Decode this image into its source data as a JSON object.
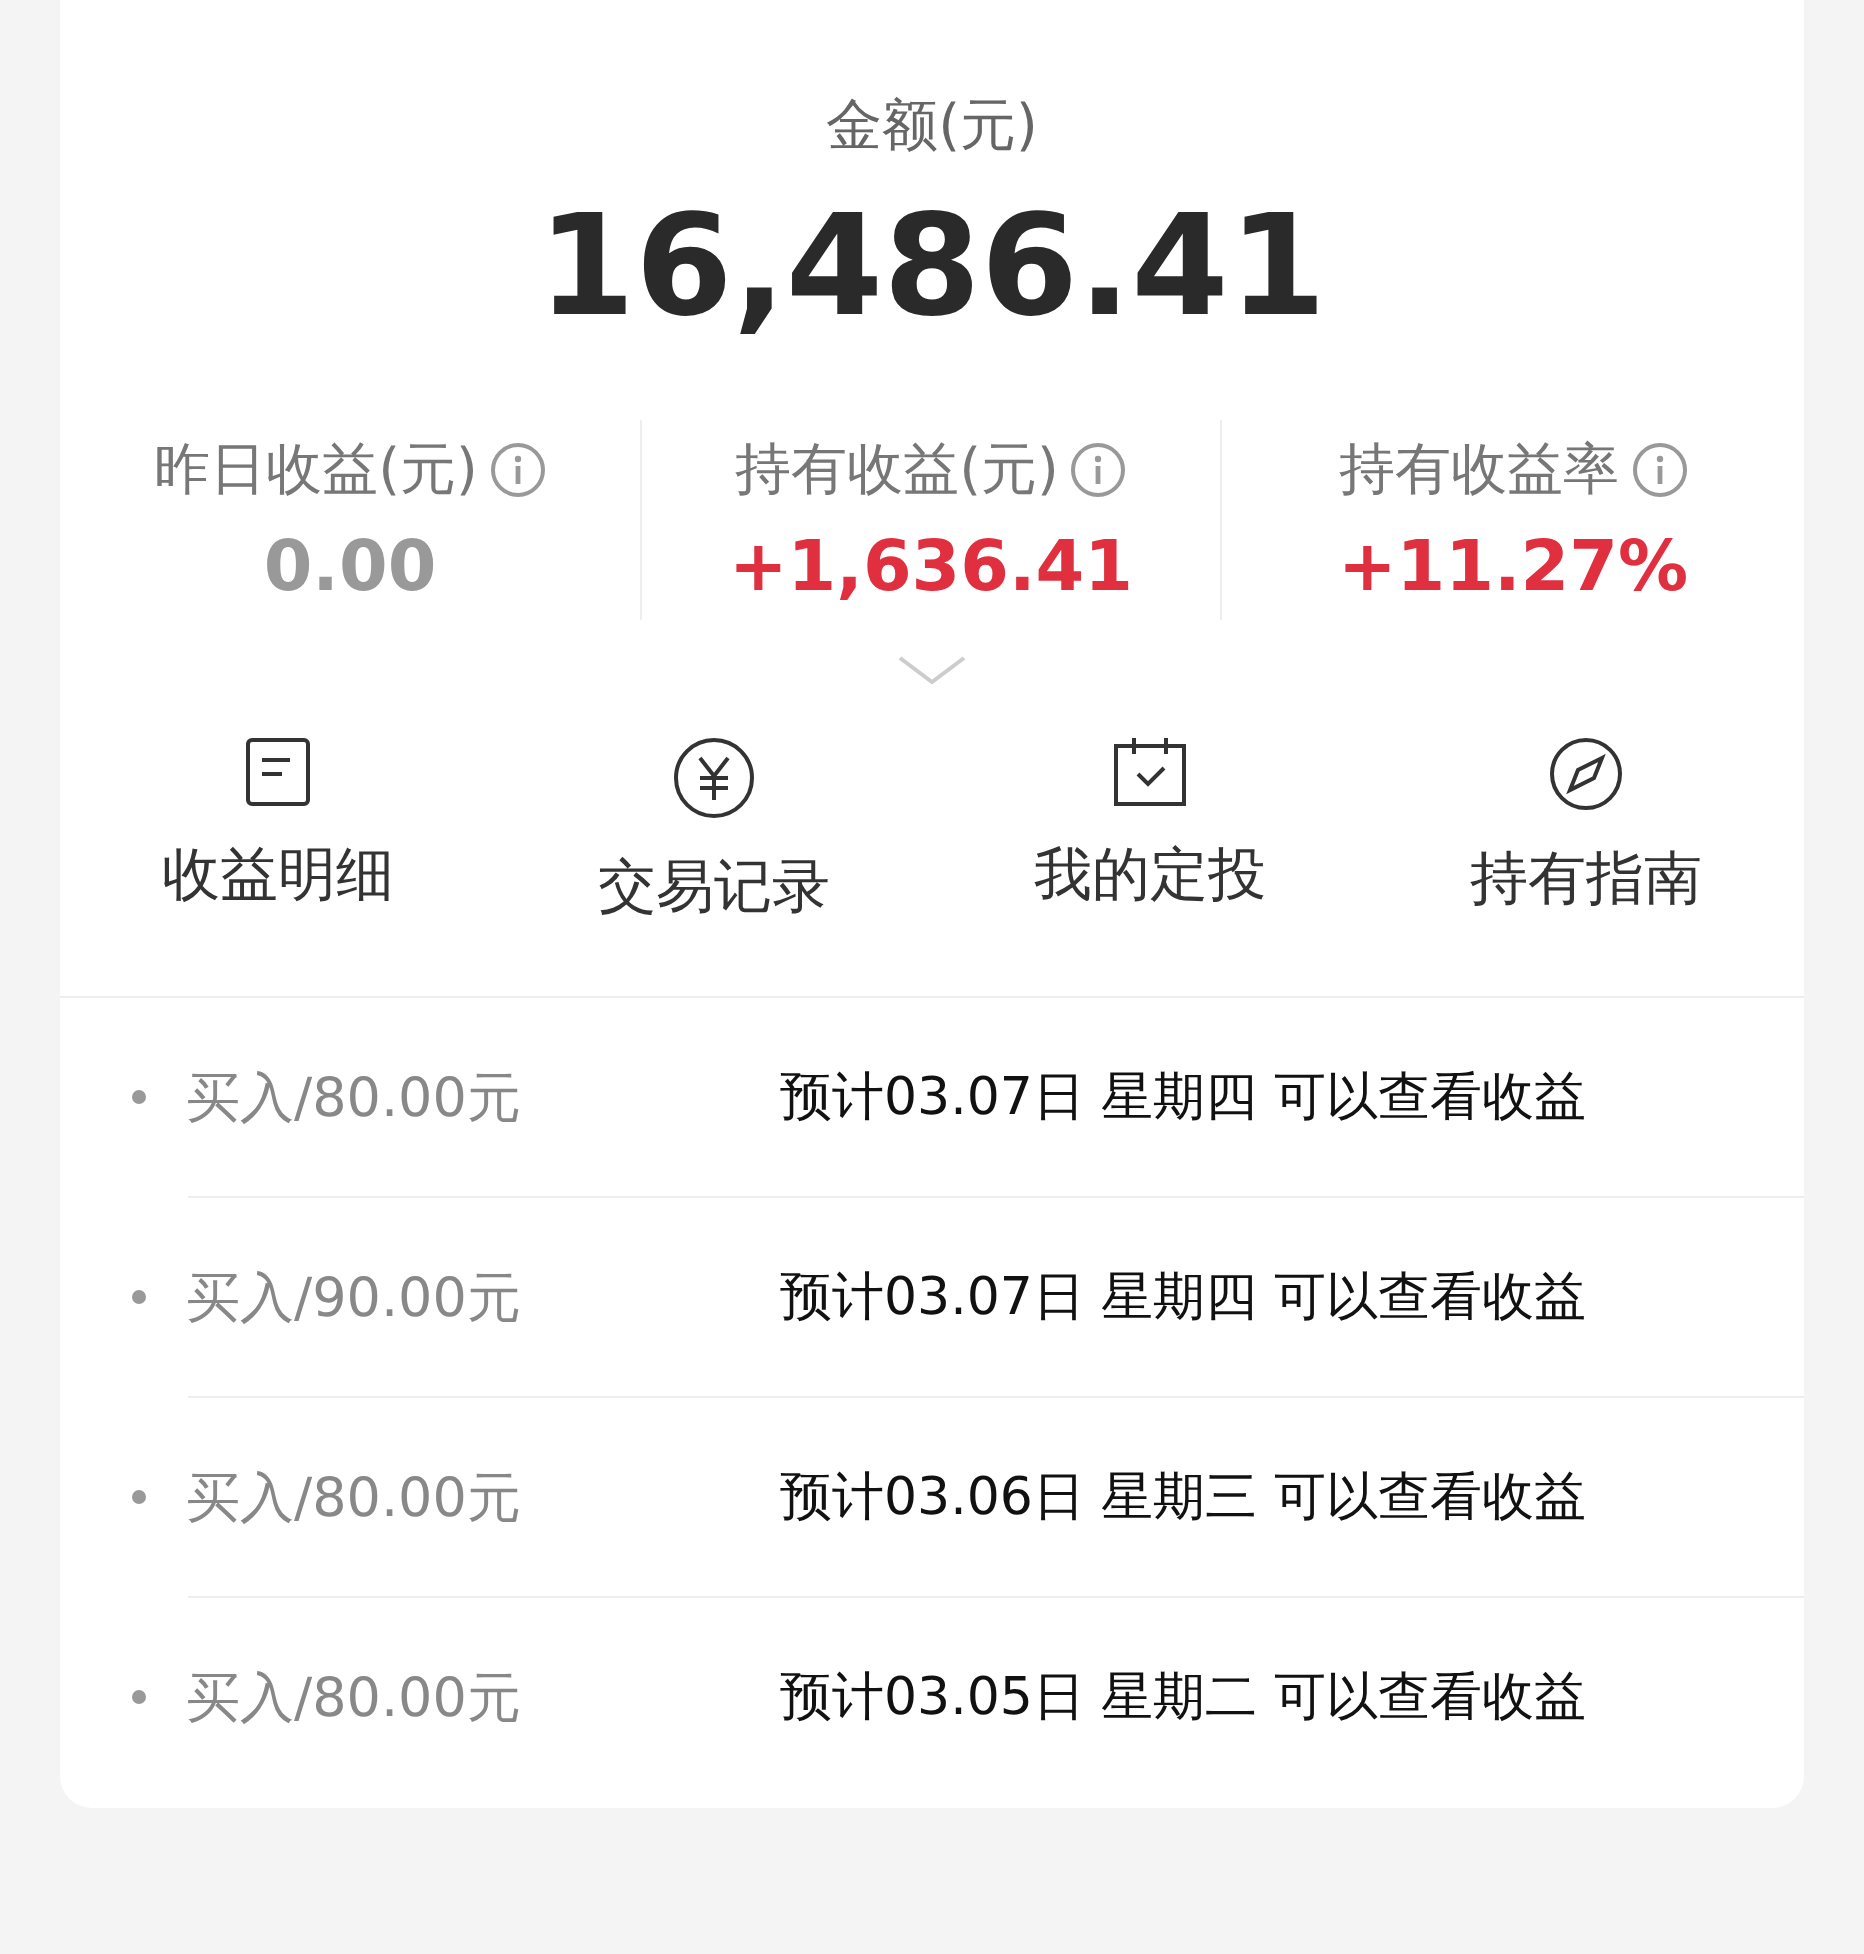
{
  "balance": {
    "label": "金额(元)",
    "amount": "16,486.41"
  },
  "stats": [
    {
      "label": "昨日收益(元)",
      "value": "0.00",
      "kind": "neutral"
    },
    {
      "label": "持有收益(元)",
      "value": "+1,636.41",
      "kind": "gain"
    },
    {
      "label": "持有收益率",
      "value": "+11.27%",
      "kind": "gain"
    }
  ],
  "actions": [
    {
      "label": "收益明细",
      "kind": "document"
    },
    {
      "label": "交易记录",
      "kind": "yen"
    },
    {
      "label": "我的定投",
      "kind": "calendar"
    },
    {
      "label": "持有指南",
      "kind": "compass"
    }
  ],
  "records": [
    {
      "title": "买入/80.00元",
      "note": "预计03.07日 星期四 可以查看收益"
    },
    {
      "title": "买入/90.00元",
      "note": "预计03.07日 星期四 可以查看收益"
    },
    {
      "title": "买入/80.00元",
      "note": "预计03.06日 星期三 可以查看收益"
    },
    {
      "title": "买入/80.00元",
      "note": "预计03.05日 星期二 可以查看收益"
    }
  ]
}
